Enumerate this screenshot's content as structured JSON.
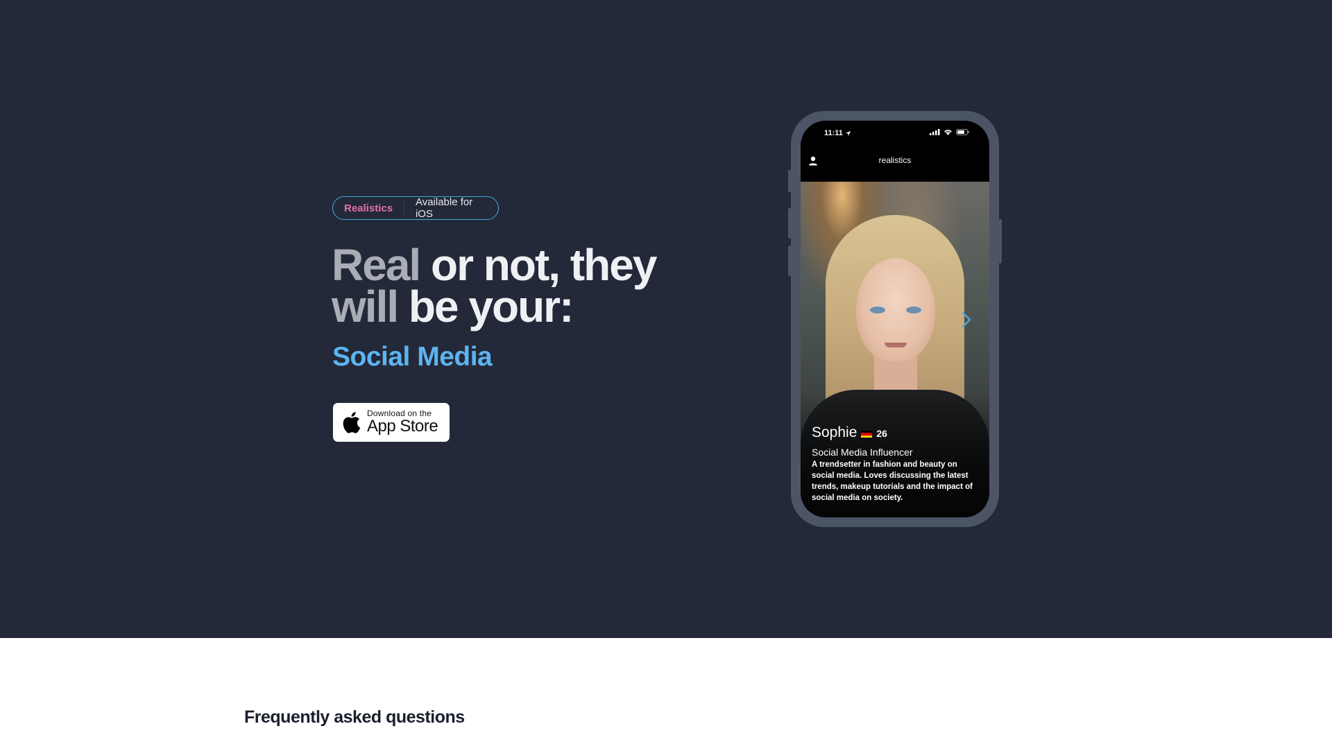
{
  "hero": {
    "badge": {
      "brand": "Realistics",
      "text": "Available for iOS"
    },
    "headline": {
      "line1_dim": "Real",
      "line1_bright": " or not, they",
      "line2_dim": "will",
      "line2_bright": " be your:"
    },
    "rotating_word": "Social Media",
    "app_store": {
      "small": "Download on the",
      "big": "App Store"
    }
  },
  "phone": {
    "status_time": "11:11",
    "app_title": "realistics",
    "profile": {
      "name": "Sophie",
      "age": "26",
      "role": "Social Media Influencer",
      "description": "A trendsetter in fashion and beauty on social media. Loves discussing the latest trends, makeup tutorials and the impact of social media on society."
    }
  },
  "faq": {
    "title": "Frequently asked questions"
  },
  "colors": {
    "hero_bg": "#232939",
    "brand_pink": "#e46fa9",
    "accent_blue": "#5db4ef",
    "phone_frame": "#4c5566"
  },
  "icons": [
    "apple-icon",
    "location-arrow-icon",
    "signal-icon",
    "wifi-icon",
    "battery-icon",
    "user-icon",
    "chevron-right-icon",
    "germany-flag-icon"
  ]
}
